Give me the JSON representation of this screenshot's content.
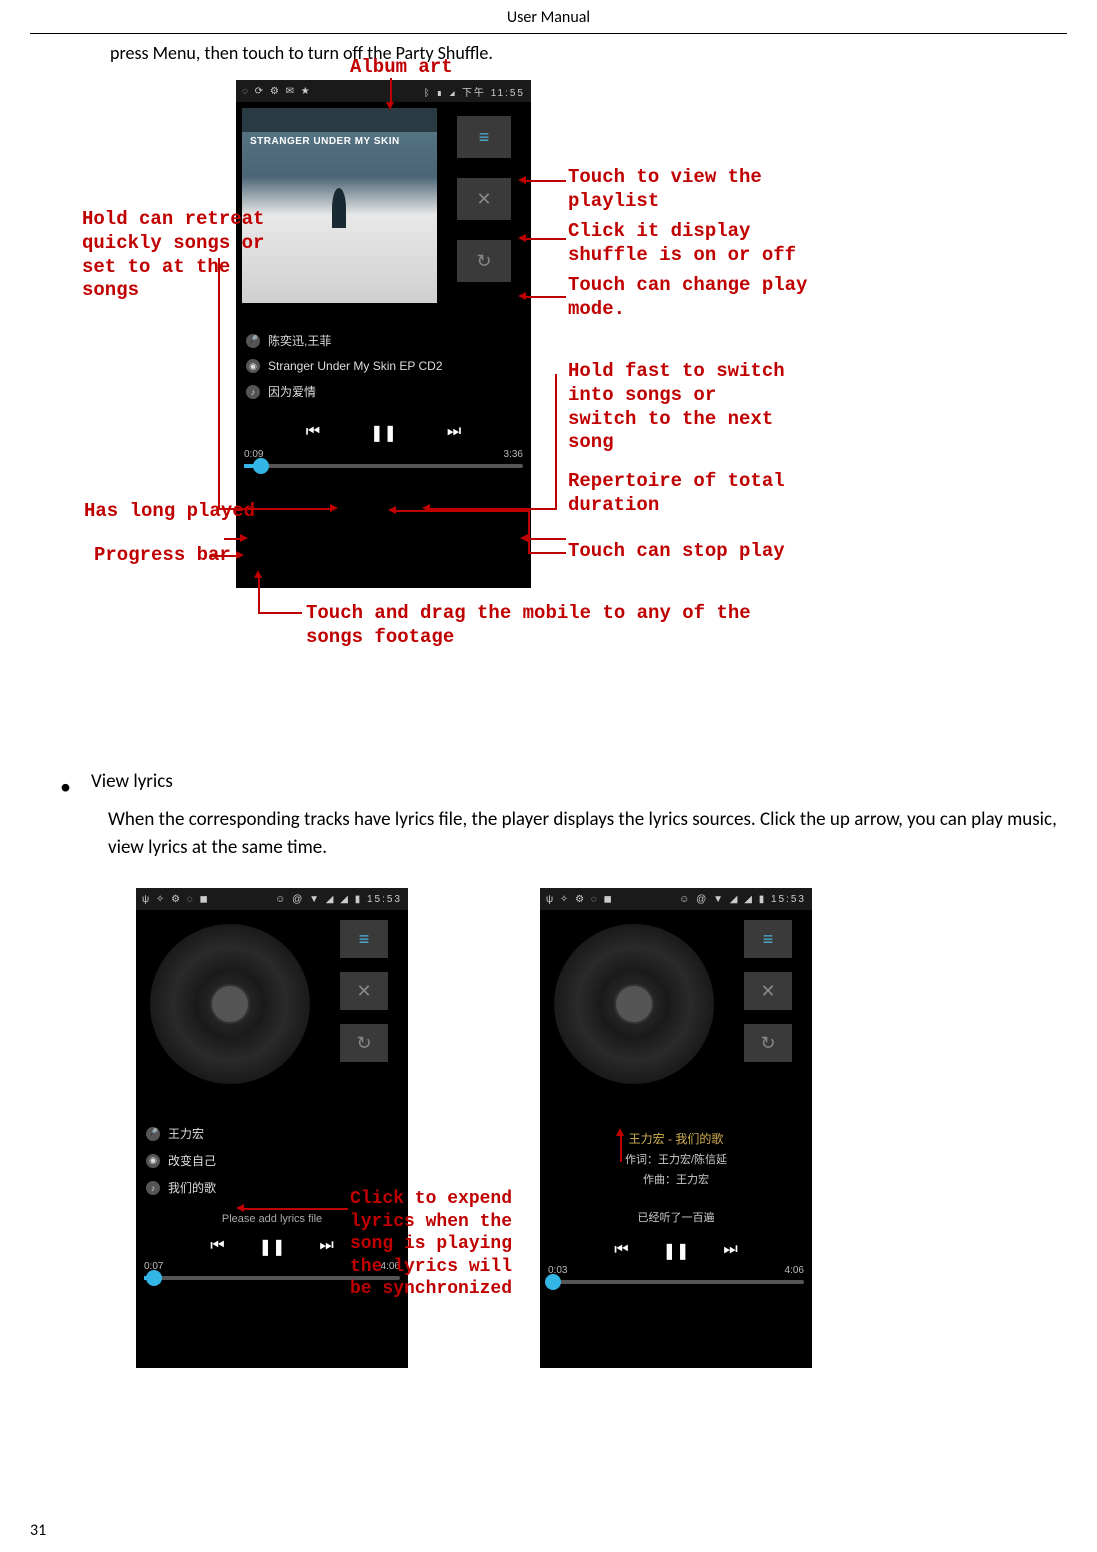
{
  "header": "User    Manual",
  "intro": "press Menu, then touch to turn off the Party Shuffle.",
  "page_number": "31",
  "annotations": {
    "album_art": "Album art",
    "view_playlist": "Touch to view the\nplaylist",
    "shuffle": "Click it display\nshuffle is on or off",
    "play_mode": "Touch can change play\nmode.",
    "retreat": "Hold can retreat\nquickly songs or\nset to at the\nsongs",
    "next_song": "Hold fast to switch\ninto songs or\nswitch to the next\nsong",
    "duration": "Repertoire of total\nduration",
    "has_played": "Has long played",
    "progress": "Progress bar",
    "stop": "Touch can stop play",
    "drag": "Touch and drag the mobile to any of the\nsongs footage",
    "expand_lyrics": "Click to expend\nlyrics when the\nsong is playing\nthe lyrics will\nbe synchronized"
  },
  "player_main": {
    "status_time": "下午 11:55",
    "album_title": "STRANGER UNDER MY SKIN",
    "artist": "陈奕迅,王菲",
    "album_name": "Stranger Under My Skin EP CD2",
    "song": "因为爱情",
    "elapsed": "0:09",
    "total": "3:36"
  },
  "section2": {
    "heading": "View lyrics",
    "body": "When the corresponding tracks have lyrics file, the player displays the lyrics sources. Click the up arrow, you can play music, view lyrics at the same time."
  },
  "player_left": {
    "status_time": "15:53",
    "artist": "王力宏",
    "album_name": "改变自己",
    "song": "我们的歌",
    "lyrics_prompt": "Please add lyrics file",
    "elapsed": "0:07",
    "total": "4:06"
  },
  "player_right": {
    "status_time": "15:53",
    "lyrics_title": "王力宏 - 我们的歌",
    "lyrics_writer": "作词：王力宏/陈信延",
    "lyrics_composer": "作曲：王力宏",
    "lyrics_sung": "已经听了一百遍",
    "elapsed": "0:03",
    "total": "4:06"
  }
}
